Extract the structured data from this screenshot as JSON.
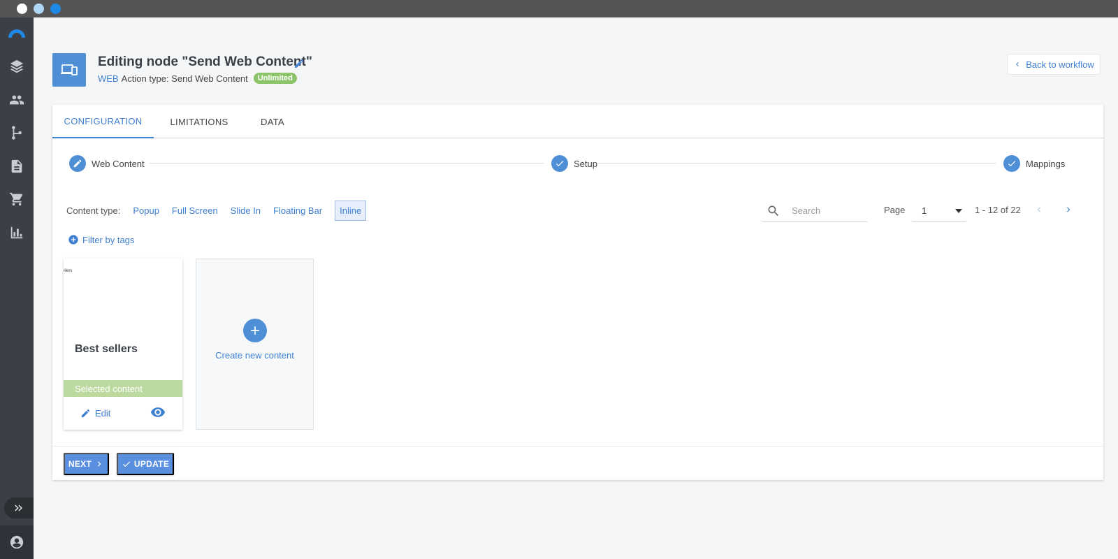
{
  "header": {
    "title": "Editing node \"Send Web Content\"",
    "channel": "WEB",
    "action_type": "Action type: Send Web Content",
    "badge": "Unlimited",
    "back_label": "Back to workflow"
  },
  "tabs": [
    {
      "label": "CONFIGURATION",
      "active": true
    },
    {
      "label": "LIMITATIONS",
      "active": false
    },
    {
      "label": "DATA",
      "active": false
    }
  ],
  "steps": [
    {
      "label": "Web Content",
      "icon": "pencil-icon"
    },
    {
      "label": "Setup",
      "icon": "check-icon"
    },
    {
      "label": "Mappings",
      "icon": "check-icon"
    }
  ],
  "filters": {
    "label": "Content type:",
    "options": [
      "Popup",
      "Full Screen",
      "Slide In",
      "Floating Bar",
      "Inline"
    ],
    "active": "Inline",
    "tags_label": "Filter by tags"
  },
  "search": {
    "placeholder": "Search",
    "value": ""
  },
  "pagination": {
    "label": "Page",
    "current": "1",
    "range": "1 - 12 of 22"
  },
  "content_items": [
    {
      "thumb_text": "ellers",
      "name": "Best sellers",
      "status": "Selected content",
      "edit_label": "Edit"
    }
  ],
  "create_label": "Create new content",
  "footer": {
    "next_label": "NEXT",
    "update_label": "UPDATE"
  },
  "colors": {
    "accent": "#4f8fd6",
    "link": "#3f7fd0",
    "badge": "#8cc46a",
    "selected": "#bcd99f",
    "sidebar": "#3b3f46"
  }
}
